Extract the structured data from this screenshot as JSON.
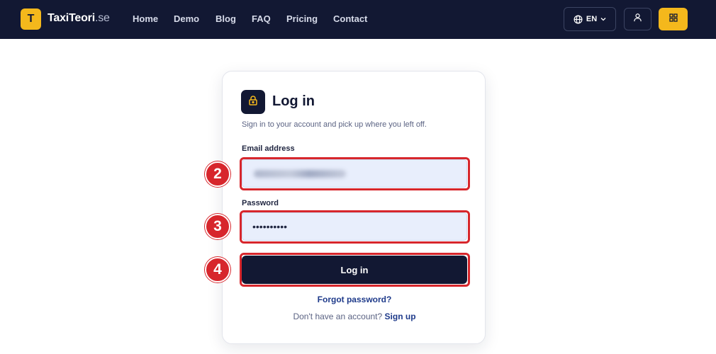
{
  "navbar": {
    "logo_letter": "T",
    "brand": "TaxiTeori",
    "tld": ".se",
    "links": [
      "Home",
      "Demo",
      "Blog",
      "FAQ",
      "Pricing",
      "Contact"
    ],
    "language": "EN",
    "icons": {
      "language": "globe-icon",
      "language_caret": "chevron-down-icon",
      "account": "user-icon",
      "menu": "grid-icon"
    },
    "colors": {
      "background": "#121833",
      "accent": "#f4b81c"
    }
  },
  "login": {
    "icon": "lock-icon",
    "title": "Log in",
    "subtitle": "Sign in to your account and pick up where you left off.",
    "email_label": "Email address",
    "password_label": "Password",
    "password_mask": "••••••••••",
    "submit_label": "Log in",
    "forgot_password": "Forgot password?",
    "signup_prompt": "Don't have an account?",
    "signup_link": "Sign up"
  },
  "annotations": {
    "color": "#d7262c",
    "steps": [
      "2",
      "3",
      "4"
    ]
  }
}
